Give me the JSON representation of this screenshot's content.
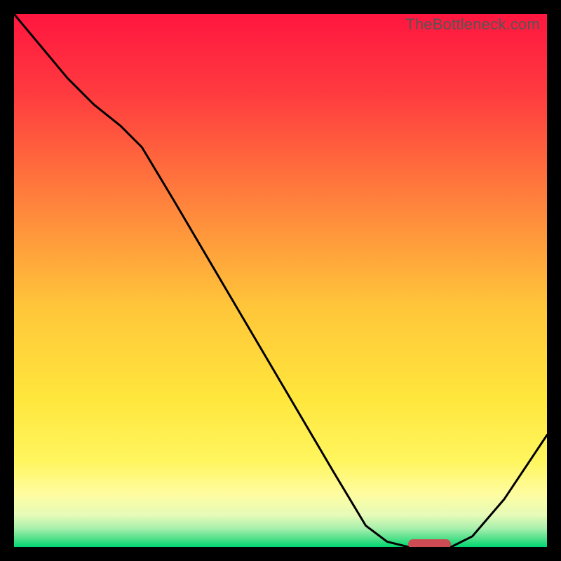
{
  "watermark": "TheBottleneck.com",
  "chart_data": {
    "type": "line",
    "title": "",
    "xlabel": "",
    "ylabel": "",
    "x": [
      0.0,
      0.05,
      0.1,
      0.15,
      0.2,
      0.24,
      0.3,
      0.4,
      0.5,
      0.6,
      0.66,
      0.7,
      0.74,
      0.8,
      0.82,
      0.86,
      0.92,
      1.0
    ],
    "y": [
      1.0,
      0.94,
      0.88,
      0.83,
      0.79,
      0.75,
      0.65,
      0.48,
      0.31,
      0.14,
      0.04,
      0.01,
      0.0,
      0.0,
      0.0,
      0.02,
      0.09,
      0.21
    ],
    "ylim": [
      0,
      1
    ],
    "xlim": [
      0,
      1
    ],
    "marker": {
      "x_start": 0.74,
      "x_end": 0.82,
      "y": 0.0
    },
    "background_gradient": {
      "type": "vertical",
      "stops": [
        {
          "pos": 0.0,
          "color": "#ff163f"
        },
        {
          "pos": 0.15,
          "color": "#ff3b3f"
        },
        {
          "pos": 0.35,
          "color": "#ff813c"
        },
        {
          "pos": 0.55,
          "color": "#ffc63a"
        },
        {
          "pos": 0.72,
          "color": "#ffe63c"
        },
        {
          "pos": 0.84,
          "color": "#fff65f"
        },
        {
          "pos": 0.9,
          "color": "#fffca0"
        },
        {
          "pos": 0.94,
          "color": "#e6fbb8"
        },
        {
          "pos": 0.965,
          "color": "#a9f0ad"
        },
        {
          "pos": 0.985,
          "color": "#4de089"
        },
        {
          "pos": 1.0,
          "color": "#00d772"
        }
      ]
    }
  }
}
